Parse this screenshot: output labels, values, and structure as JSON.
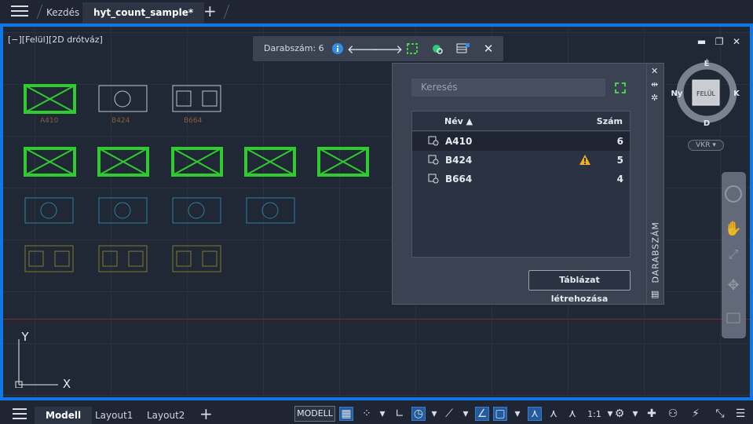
{
  "tabs": {
    "home": "Kezdés",
    "file": "hyt_count_sample*",
    "new_tab": "+"
  },
  "viewport": {
    "label": "[−][Felül][2D drótváz]",
    "blocks": {
      "row1_labels": [
        "A410",
        "B424",
        "B664"
      ]
    }
  },
  "count_toolbar": {
    "label": "Darabszám:",
    "value": "6"
  },
  "count_panel": {
    "title": "DARABSZÁM",
    "search_placeholder": "Keresés",
    "columns": {
      "name": "Név ▲",
      "count": "Szám"
    },
    "rows": [
      {
        "name": "A410",
        "count": "6",
        "selected": true,
        "warning": false
      },
      {
        "name": "B424",
        "count": "5",
        "selected": false,
        "warning": true
      },
      {
        "name": "B664",
        "count": "4",
        "selected": false,
        "warning": false
      }
    ],
    "create_table_label": "Táblázat létrehozása"
  },
  "viewcube": {
    "north": "É",
    "south": "D",
    "west": "Ny",
    "east": "K",
    "face": "FELÜL",
    "wcs": "VKR"
  },
  "ucs": {
    "x": "X",
    "y": "Y"
  },
  "status_bar": {
    "tabs": [
      "Modell",
      "Layout1",
      "Layout2"
    ],
    "model_button": "MODELL",
    "scale": "1:1"
  },
  "colors": {
    "accent": "#1177e6",
    "highlight": "#2ecc2e",
    "warning": "#f2b01e"
  }
}
